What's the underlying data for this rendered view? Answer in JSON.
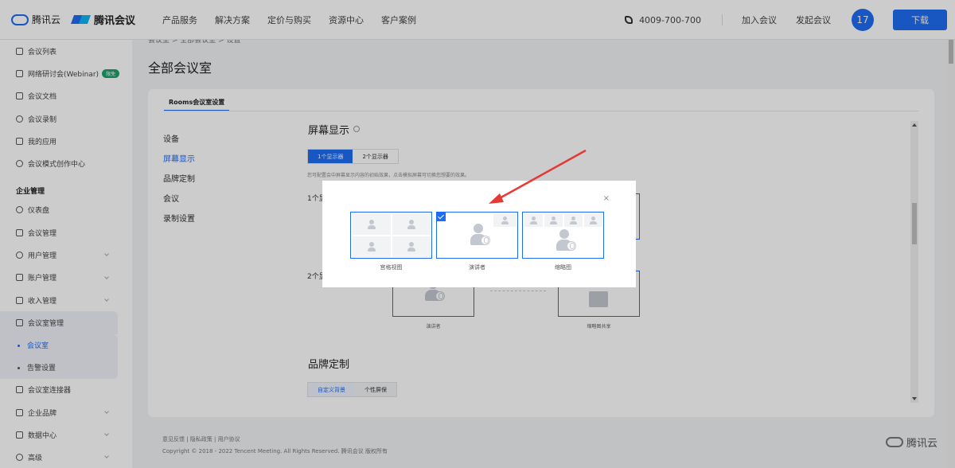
{
  "header": {
    "brand_cloud": "腾讯云",
    "brand_meeting": "腾讯会议",
    "nav": [
      "产品服务",
      "解决方案",
      "定价与购买",
      "资源中心",
      "客户案例"
    ],
    "phone": "4009-700-700",
    "join_meeting": "加入会议",
    "start_meeting": "发起会议",
    "avatar": "17",
    "download": "下载"
  },
  "sidebar": {
    "items_top": [
      {
        "label": "会议列表",
        "icon": "list-icon"
      },
      {
        "label": "网络研讨会(Webinar)",
        "icon": "webinar-icon",
        "badge": "限免"
      },
      {
        "label": "会议文档",
        "icon": "document-icon"
      },
      {
        "label": "会议录制",
        "icon": "record-icon"
      },
      {
        "label": "我的应用",
        "icon": "apps-icon"
      },
      {
        "label": "会议模式创作中心",
        "icon": "creation-icon"
      }
    ],
    "group": "企业管理",
    "items_manage": [
      {
        "label": "仪表盘",
        "icon": "dashboard-icon"
      },
      {
        "label": "会议管理",
        "icon": "grid-icon"
      },
      {
        "label": "用户管理",
        "icon": "user-icon"
      },
      {
        "label": "账户管理",
        "icon": "account-icon"
      },
      {
        "label": "收入管理",
        "icon": "income-icon"
      },
      {
        "label": "会议室管理",
        "icon": "room-icon"
      }
    ],
    "sub_items": [
      {
        "label": "会议室",
        "active": true
      },
      {
        "label": "告警设置",
        "active": false
      }
    ],
    "items_bottom": [
      {
        "label": "会议室连接器",
        "icon": "connector-icon"
      },
      {
        "label": "企业品牌",
        "icon": "brand-icon"
      },
      {
        "label": "数据中心",
        "icon": "data-icon"
      },
      {
        "label": "高级",
        "icon": "advanced-icon"
      }
    ]
  },
  "breadcrumb": "会议室 > 全部会议室 > 设置",
  "page_title": "全部会议室",
  "card": {
    "tab": "Rooms会议室设置",
    "nav": [
      "设备",
      "屏幕显示",
      "品牌定制",
      "会议",
      "录制设置"
    ],
    "active_nav": "屏幕显示",
    "screen_title": "屏幕显示",
    "monitor_tabs": [
      "1个显示器",
      "2个显示器"
    ],
    "description": "您可配置会中屏幕显示内容的初始效果，点击模拟屏幕可切换您想要的效果。",
    "row1_label": "1个显示器",
    "row2_label": "2个显示器",
    "bg_captions": [
      "演讲者",
      "缩略图共享"
    ],
    "brand_title": "品牌定制",
    "brand_tabs": [
      "自定义背景",
      "个性屏保"
    ]
  },
  "dialog": {
    "close": "×",
    "options": [
      {
        "caption": "宫格视图",
        "selected": false
      },
      {
        "caption": "演讲者",
        "selected": true
      },
      {
        "caption": "缩略图",
        "selected": false
      }
    ]
  },
  "footer": {
    "links": "意见反馈 | 隐私政策 | 用户协议",
    "copyright": "Copyright © 2018 - 2022 Tencent Meeting. All Rights Reserved. 腾讯会议 版权所有",
    "brand": "腾讯云"
  },
  "colors": {
    "accent": "#1e6cf2",
    "annotation_arrow": "#e53935"
  }
}
